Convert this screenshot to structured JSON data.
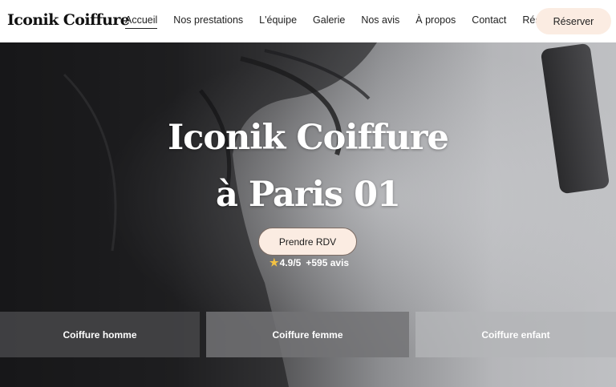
{
  "header": {
    "logo": "Iconik Coiffure",
    "nav": [
      {
        "label": "Accueil",
        "active": true
      },
      {
        "label": "Nos prestations"
      },
      {
        "label": "L'équipe"
      },
      {
        "label": "Galerie"
      },
      {
        "label": "Nos avis"
      },
      {
        "label": "À propos"
      },
      {
        "label": "Contact"
      },
      {
        "label": "Réserver"
      }
    ],
    "cta_label": "Réserver"
  },
  "hero": {
    "title_line1": "Iconik Coiffure",
    "title_line2": "à Paris 01",
    "button_label": "Prendre RDV",
    "rating": "4.9/5",
    "reviews": "+595 avis",
    "services": [
      "Coiffure homme",
      "Coiffure femme",
      "Coiffure enfant"
    ]
  },
  "colors": {
    "accent": "#fbece2",
    "star": "#f3c243"
  }
}
